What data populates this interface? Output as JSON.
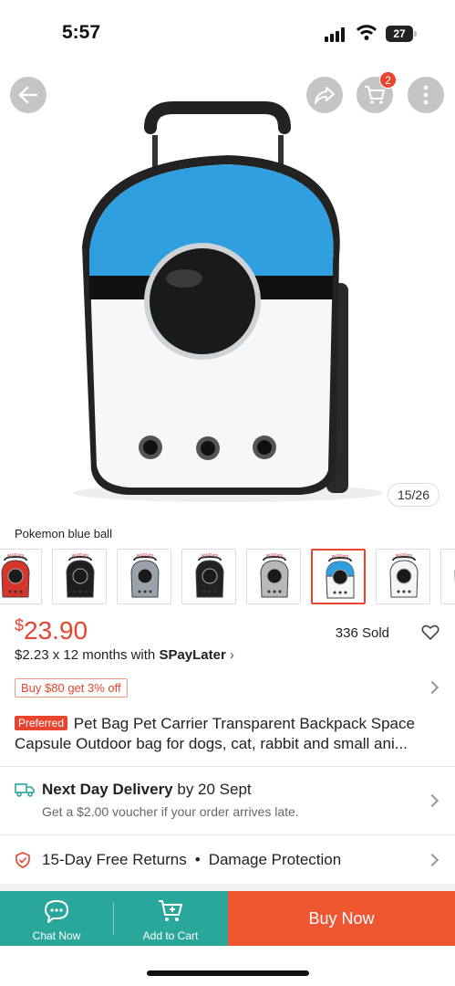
{
  "status_bar": {
    "time": "5:57",
    "battery": "27"
  },
  "header": {
    "cart_count": "2",
    "image_counter": "15/26"
  },
  "product": {
    "variant_name": "Pokemon blue ball",
    "price_currency": "$",
    "price_amount": "23.90",
    "sold": "336 Sold",
    "installment_prefix": "$2.23 x 12 months with ",
    "installment_brand": "SPayLater",
    "promo": "Buy $80 get 3% off",
    "preferred_tag": "Preferred",
    "title_line1": " Pet Bag Pet Carrier Transparent Backpack Space",
    "title_line2": "Capsule Outdoor bag for dogs, cat, rabbit and small ani..."
  },
  "delivery": {
    "title_bold": "Next Day Delivery",
    "title_rest": " by 20 Sept",
    "subtitle": "Get a $2.00 voucher if your order arrives late."
  },
  "returns": {
    "left": "15-Day Free Returns",
    "dot": "•",
    "right": "Damage Protection"
  },
  "bottom_bar": {
    "chat_label": "Chat Now",
    "add_to_cart_label": "Add to Cart",
    "buy_now_label": "Buy Now"
  },
  "thumbnail_brand": "wi⚲Pets",
  "colors": {
    "accent": "#e8442f",
    "teal": "#2aa79b",
    "buy": "#ef5632",
    "capsule_blue": "#2f9fe0"
  }
}
